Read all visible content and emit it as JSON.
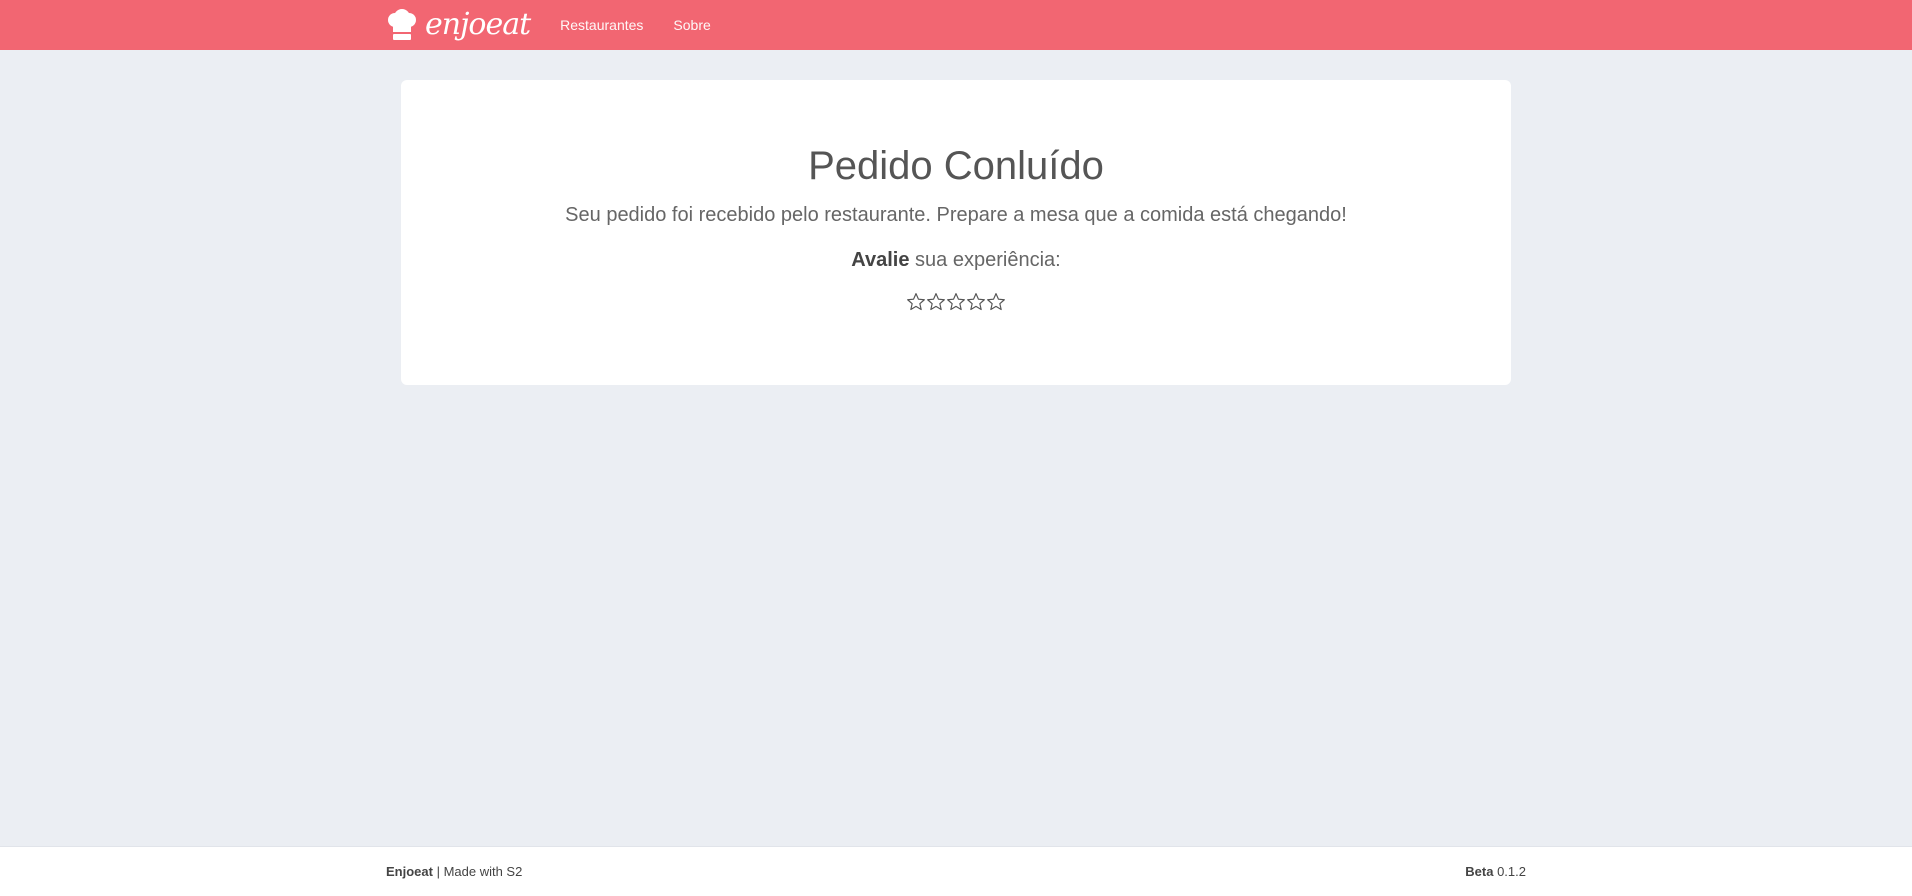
{
  "nav": {
    "brand": "enjoeat",
    "links": [
      "Restaurantes",
      "Sobre"
    ]
  },
  "card": {
    "title": "Pedido Conluído",
    "subtitle": "Seu pedido foi recebido pelo restaurante. Prepare a mesa que a comida está chegando!",
    "rate_bold": "Avalie",
    "rate_rest": " sua experiência:",
    "stars_total": 5,
    "stars_filled": 0
  },
  "footer": {
    "left_bold": "Enjoeat",
    "left_text": " | Made with S2",
    "right_bold": "Beta",
    "right_text": " 0.1.2"
  },
  "colors": {
    "topbar": "#f26672",
    "background": "#ebeef3",
    "card": "#ffffff"
  }
}
